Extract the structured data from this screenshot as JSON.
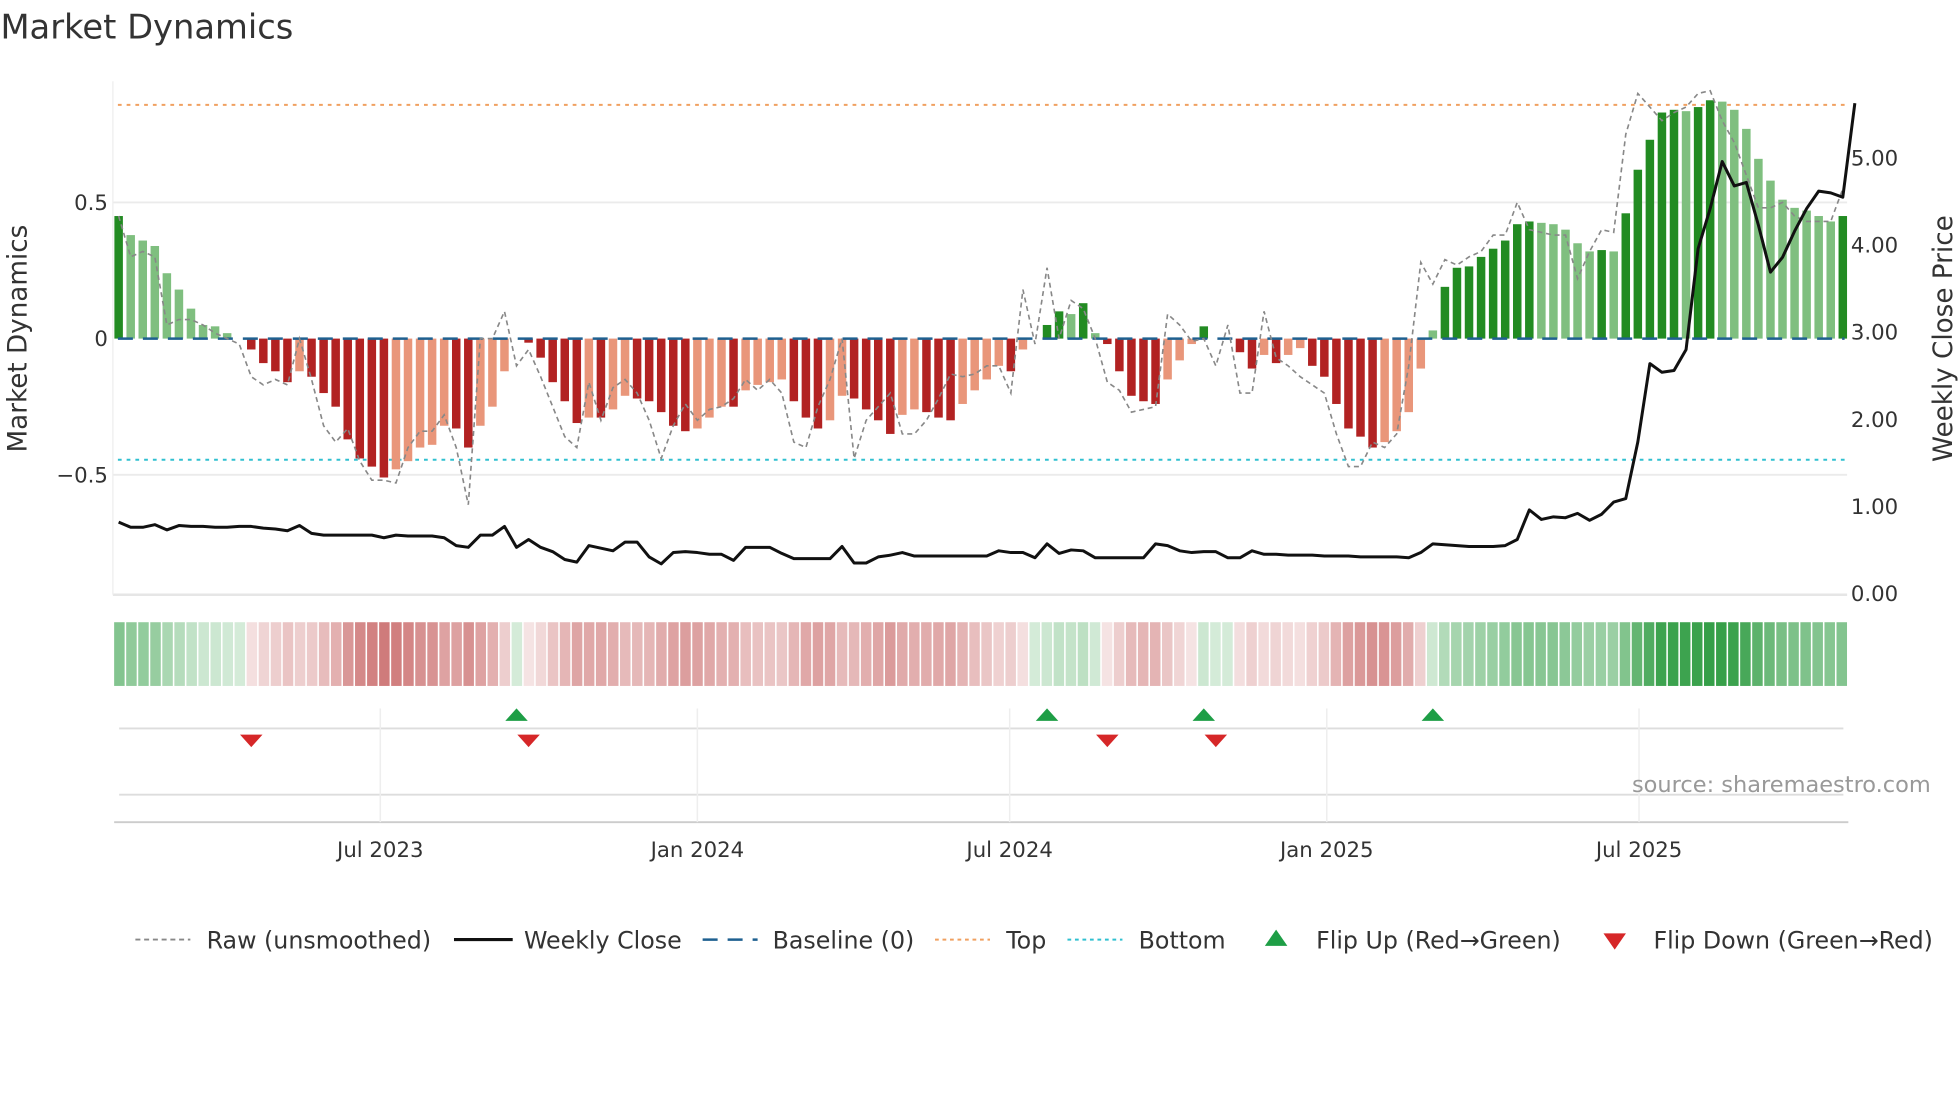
{
  "chart_data": {
    "type": "bar",
    "title": "Market Dynamics",
    "ylabel": "Market Dynamics",
    "y2label": "Weekly Close Price",
    "ylim": [
      -0.94,
      0.95
    ],
    "y2lim": [
      0,
      5.9
    ],
    "yticks": [
      {
        "label": "0.5",
        "value": 0.5
      },
      {
        "label": "0",
        "value": 0
      },
      {
        "label": "−0.5",
        "value": -0.5
      }
    ],
    "y2ticks": [
      {
        "label": "5.00",
        "value": 5
      },
      {
        "label": "4.00",
        "value": 4
      },
      {
        "label": "3.00",
        "value": 3
      },
      {
        "label": "2.00",
        "value": 2
      },
      {
        "label": "1.00",
        "value": 1
      },
      {
        "label": "0.00",
        "value": 0
      }
    ],
    "xticks": [
      {
        "label": "Jul 2023",
        "week_index": 21.7
      },
      {
        "label": "Jan 2024",
        "week_index": 48.0
      },
      {
        "label": "Jul 2024",
        "week_index": 73.9
      },
      {
        "label": "Jan 2025",
        "week_index": 100.2
      },
      {
        "label": "Jul 2025",
        "week_index": 126.1
      }
    ],
    "thresholds": {
      "top": 0.858,
      "bottom": -0.445,
      "baseline": 0
    },
    "series": [
      {
        "name": "Market Dynamics (smoothed)",
        "type": "bar",
        "values": [
          0.45,
          0.38,
          0.36,
          0.34,
          0.24,
          0.18,
          0.11,
          0.05,
          0.045,
          0.02,
          0.0,
          -0.04,
          -0.09,
          -0.12,
          -0.16,
          -0.12,
          -0.14,
          -0.2,
          -0.25,
          -0.37,
          -0.44,
          -0.47,
          -0.51,
          -0.48,
          -0.45,
          -0.4,
          -0.39,
          -0.32,
          -0.33,
          -0.4,
          -0.32,
          -0.25,
          -0.12,
          0.0,
          -0.015,
          -0.07,
          -0.16,
          -0.23,
          -0.31,
          -0.29,
          -0.29,
          -0.26,
          -0.21,
          -0.22,
          -0.23,
          -0.27,
          -0.32,
          -0.34,
          -0.33,
          -0.29,
          -0.25,
          -0.25,
          -0.19,
          -0.17,
          -0.16,
          -0.15,
          -0.23,
          -0.29,
          -0.33,
          -0.3,
          -0.21,
          -0.22,
          -0.26,
          -0.3,
          -0.35,
          -0.28,
          -0.26,
          -0.27,
          -0.29,
          -0.3,
          -0.24,
          -0.19,
          -0.15,
          -0.1,
          -0.12,
          -0.04,
          0.0,
          0.05,
          0.1,
          0.09,
          0.13,
          0.02,
          -0.02,
          -0.12,
          -0.21,
          -0.23,
          -0.24,
          -0.15,
          -0.08,
          -0.02,
          0.045,
          0.0,
          0.0,
          -0.05,
          -0.11,
          -0.06,
          -0.09,
          -0.06,
          -0.035,
          -0.1,
          -0.14,
          -0.24,
          -0.33,
          -0.36,
          -0.4,
          -0.38,
          -0.34,
          -0.27,
          -0.11,
          0.03,
          0.19,
          0.26,
          0.265,
          0.3,
          0.33,
          0.36,
          0.42,
          0.43,
          0.425,
          0.42,
          0.4,
          0.35,
          0.32,
          0.325,
          0.32,
          0.46,
          0.62,
          0.73,
          0.83,
          0.84,
          0.835,
          0.85,
          0.875,
          0.87,
          0.84,
          0.77,
          0.66,
          0.58,
          0.51,
          0.48,
          0.47,
          0.45,
          0.43,
          0.45
        ]
      },
      {
        "name": "Raw (unsmoothed)",
        "type": "line",
        "values": [
          0.45,
          0.3,
          0.32,
          0.3,
          0.05,
          0.07,
          0.07,
          0.05,
          0.02,
          0.0,
          -0.02,
          -0.14,
          -0.17,
          -0.15,
          -0.17,
          0.0,
          -0.15,
          -0.32,
          -0.38,
          -0.33,
          -0.45,
          -0.52,
          -0.52,
          -0.53,
          -0.4,
          -0.34,
          -0.34,
          -0.28,
          -0.4,
          -0.61,
          0.0,
          0.0,
          0.1,
          -0.1,
          -0.04,
          -0.14,
          -0.25,
          -0.36,
          -0.4,
          -0.16,
          -0.3,
          -0.18,
          -0.15,
          -0.2,
          -0.3,
          -0.44,
          -0.32,
          -0.24,
          -0.3,
          -0.26,
          -0.25,
          -0.22,
          -0.15,
          -0.19,
          -0.15,
          -0.2,
          -0.38,
          -0.4,
          -0.25,
          -0.15,
          0.0,
          -0.44,
          -0.3,
          -0.25,
          -0.2,
          -0.35,
          -0.35,
          -0.3,
          -0.22,
          -0.13,
          -0.14,
          -0.13,
          -0.1,
          -0.1,
          -0.2,
          0.18,
          -0.02,
          0.26,
          0.0,
          0.14,
          0.11,
          0.0,
          -0.16,
          -0.19,
          -0.27,
          -0.26,
          -0.25,
          0.09,
          0.05,
          -0.01,
          0.0,
          -0.1,
          0.05,
          -0.2,
          -0.2,
          0.1,
          -0.07,
          -0.1,
          -0.14,
          -0.17,
          -0.2,
          -0.35,
          -0.47,
          -0.47,
          -0.38,
          -0.4,
          -0.35,
          -0.1,
          0.28,
          0.2,
          0.29,
          0.27,
          0.3,
          0.32,
          0.38,
          0.38,
          0.5,
          0.4,
          0.39,
          0.38,
          0.38,
          0.22,
          0.32,
          0.4,
          0.39,
          0.75,
          0.9,
          0.85,
          0.8,
          0.83,
          0.85,
          0.9,
          0.91,
          0.8,
          0.72,
          0.6,
          0.48,
          0.48,
          0.5,
          0.45,
          0.43,
          0.43,
          0.43,
          0.55
        ]
      },
      {
        "name": "Weekly Close",
        "type": "line",
        "axis": "right",
        "values": [
          0.82,
          0.76,
          0.76,
          0.79,
          0.73,
          0.78,
          0.77,
          0.77,
          0.76,
          0.76,
          0.77,
          0.77,
          0.75,
          0.74,
          0.72,
          0.78,
          0.69,
          0.67,
          0.67,
          0.67,
          0.67,
          0.67,
          0.64,
          0.67,
          0.66,
          0.66,
          0.66,
          0.64,
          0.55,
          0.53,
          0.67,
          0.67,
          0.77,
          0.53,
          0.62,
          0.53,
          0.48,
          0.39,
          0.36,
          0.55,
          0.52,
          0.49,
          0.59,
          0.59,
          0.42,
          0.34,
          0.47,
          0.48,
          0.47,
          0.45,
          0.45,
          0.38,
          0.53,
          0.53,
          0.53,
          0.46,
          0.4,
          0.4,
          0.4,
          0.4,
          0.54,
          0.35,
          0.35,
          0.42,
          0.44,
          0.47,
          0.43,
          0.43,
          0.43,
          0.43,
          0.43,
          0.43,
          0.43,
          0.49,
          0.47,
          0.47,
          0.41,
          0.57,
          0.46,
          0.5,
          0.49,
          0.41,
          0.41,
          0.41,
          0.41,
          0.41,
          0.57,
          0.55,
          0.49,
          0.47,
          0.48,
          0.48,
          0.41,
          0.41,
          0.49,
          0.45,
          0.45,
          0.44,
          0.44,
          0.44,
          0.43,
          0.43,
          0.43,
          0.42,
          0.42,
          0.42,
          0.42,
          0.41,
          0.47,
          0.57,
          0.56,
          0.55,
          0.54,
          0.54,
          0.54,
          0.55,
          0.62,
          0.96,
          0.85,
          0.88,
          0.87,
          0.92,
          0.84,
          0.91,
          1.05,
          1.09,
          1.74,
          2.64,
          2.54,
          2.56,
          2.8,
          3.96,
          4.42,
          4.96,
          4.68,
          4.72,
          4.23,
          3.69,
          3.86,
          4.16,
          4.42,
          4.62,
          4.6,
          4.55,
          5.63
        ]
      }
    ],
    "flip_up_week_indices": [
      33,
      77,
      90,
      109
    ],
    "flip_down_week_indices": [
      11,
      34,
      82,
      91
    ],
    "colors": {
      "dark_green": "#228b22",
      "light_green": "#7fbf7f",
      "dark_red": "#b22222",
      "light_red": "#e9967a",
      "top": "#f0a060",
      "bottom": "#30c0d0",
      "baseline": "#1f6090",
      "flip_up": "#1e9e46",
      "flip_down": "#d62728",
      "raw": "#888888",
      "close": "#111111"
    },
    "legend": {
      "placement": "bottom",
      "items": [
        {
          "label": "Raw (unsmoothed)",
          "key": "raw"
        },
        {
          "label": "Weekly Close",
          "key": "close"
        },
        {
          "label": "Baseline (0)",
          "key": "baseline"
        },
        {
          "label": "Top",
          "key": "top"
        },
        {
          "label": "Bottom",
          "key": "bottom"
        },
        {
          "label": "Flip Up (Red→Green)",
          "key": "flip_up"
        },
        {
          "label": "Flip Down (Green→Red)",
          "key": "flip_down"
        }
      ]
    },
    "source": "source: sharemaestro.com"
  }
}
